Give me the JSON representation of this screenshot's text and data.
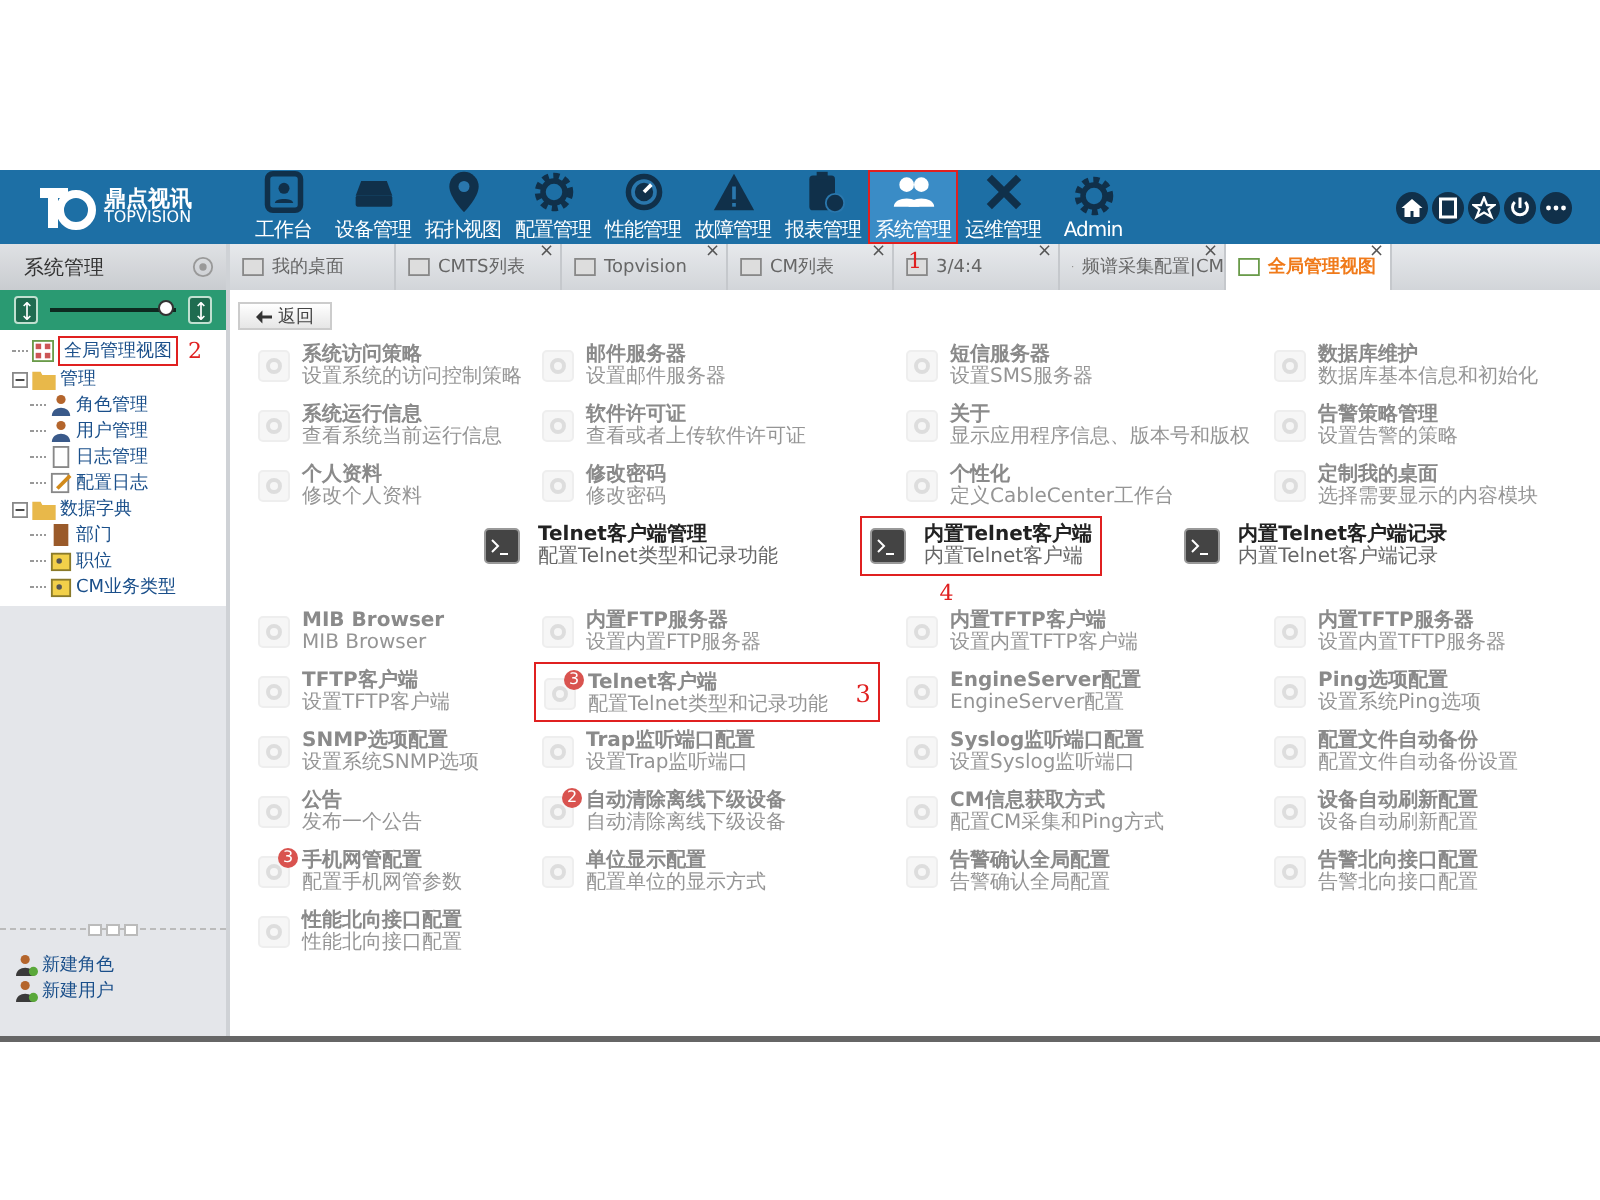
{
  "header": {
    "logo_cn": "鼎点视讯",
    "logo_en": "TOPVISION",
    "nav": [
      {
        "label": "工作台",
        "kind": "card",
        "selected": false
      },
      {
        "label": "设备管理",
        "kind": "drive",
        "selected": false
      },
      {
        "label": "拓扑视图",
        "kind": "pin",
        "selected": false
      },
      {
        "label": "配置管理",
        "kind": "gear",
        "selected": false
      },
      {
        "label": "性能管理",
        "kind": "gauge",
        "selected": false
      },
      {
        "label": "故障管理",
        "kind": "warning",
        "selected": false
      },
      {
        "label": "报表管理",
        "kind": "clipboard",
        "selected": false
      },
      {
        "label": "系统管理",
        "kind": "users",
        "selected": true,
        "annotation": "1"
      },
      {
        "label": "运维管理",
        "kind": "tools",
        "selected": false
      },
      {
        "label": "Admin",
        "kind": "gear",
        "selected": false
      }
    ],
    "actions": [
      {
        "kind": "home"
      },
      {
        "kind": "book"
      },
      {
        "kind": "star"
      },
      {
        "kind": "power"
      },
      {
        "kind": "more"
      }
    ]
  },
  "sidebar": {
    "title": "系统管理",
    "slider": {
      "level": 0.92
    },
    "tree": [
      {
        "label": "全局管理视图",
        "kind": "grid",
        "annotation": "2"
      },
      {
        "label": "管理",
        "kind": "folder",
        "expanded": true,
        "children": [
          {
            "label": "角色管理",
            "kind": "user"
          },
          {
            "label": "用户管理",
            "kind": "user"
          },
          {
            "label": "日志管理",
            "kind": "page"
          },
          {
            "label": "配置日志",
            "kind": "edit"
          }
        ]
      },
      {
        "label": "数据字典",
        "kind": "folder",
        "expanded": true,
        "children": [
          {
            "label": "部门",
            "kind": "door"
          },
          {
            "label": "职位",
            "kind": "badge"
          },
          {
            "label": "CM业务类型",
            "kind": "badge"
          }
        ]
      }
    ],
    "footer": [
      {
        "label": "新建角色"
      },
      {
        "label": "新建用户"
      }
    ]
  },
  "tabs": [
    {
      "label": "我的桌面",
      "selected": false
    },
    {
      "label": "CMTS列表",
      "selected": false,
      "close": "×"
    },
    {
      "label": "Topvision",
      "selected": false,
      "close": "×"
    },
    {
      "label": "CM列表",
      "selected": false,
      "close": "×"
    },
    {
      "label": "3/4:4",
      "selected": false,
      "close": "×"
    },
    {
      "label": "频谱采集配置|CM",
      "selected": false,
      "close": "×"
    },
    {
      "label": "全局管理视图",
      "selected": true,
      "close": "×"
    }
  ],
  "back_button": "返回",
  "grid": [
    {
      "title": "系统访问策略",
      "desc": "设置系统的访问控制策略"
    },
    {
      "title": "邮件服务器",
      "desc": "设置邮件服务器"
    },
    {
      "title": "短信服务器",
      "desc": "设置SMS服务器"
    },
    {
      "title": "数据库维护",
      "desc": "数据库基本信息和初始化"
    },
    {
      "title": "系统运行信息",
      "desc": "查看系统当前运行信息"
    },
    {
      "title": "软件许可证",
      "desc": "查看或者上传软件许可证"
    },
    {
      "title": "关于",
      "desc": "显示应用程序信息、版本号和版权"
    },
    {
      "title": "告警策略管理",
      "desc": "设置告警的策略"
    },
    {
      "title": "个人资料",
      "desc": "修改个人资料"
    },
    {
      "title": "修改密码",
      "desc": "修改密码"
    },
    {
      "title": "个性化",
      "desc": "定义CableCenter工作台"
    },
    {
      "title": "定制我的桌面",
      "desc": "选择需要显示的内容模块"
    },
    {
      "title": "MIB Browser",
      "desc": "MIB Browser"
    },
    {
      "title": "内置FTP服务器",
      "desc": "设置内置FTP服务器"
    },
    {
      "title": "内置TFTP客户端",
      "desc": "设置内置TFTP客户端"
    },
    {
      "title": "内置TFTP服务器",
      "desc": "设置内置TFTP服务器"
    },
    {
      "title": "TFTP客户端",
      "desc": "设置TFTP客户端"
    },
    {
      "title": "Telnet客户端",
      "desc": "配置Telnet类型和记录功能",
      "badge": "3",
      "annotation": "3"
    },
    {
      "title": "EngineServer配置",
      "desc": "EngineServer配置"
    },
    {
      "title": "Ping选项配置",
      "desc": "设置系统Ping选项"
    },
    {
      "title": "SNMP选项配置",
      "desc": "设置系统SNMP选项"
    },
    {
      "title": "Trap监听端口配置",
      "desc": "设置Trap监听端口"
    },
    {
      "title": "Syslog监听端口配置",
      "desc": "设置Syslog监听端口"
    },
    {
      "title": "配置文件自动备份",
      "desc": "配置文件自动备份设置"
    },
    {
      "title": "公告",
      "desc": "发布一个公告"
    },
    {
      "title": "自动清除离线下级设备",
      "desc": "自动清除离线下级设备",
      "badge": "2"
    },
    {
      "title": "CM信息获取方式",
      "desc": "配置CM采集和Ping方式"
    },
    {
      "title": "设备自动刷新配置",
      "desc": "设备自动刷新配置"
    },
    {
      "title": "手机网管配置",
      "desc": "配置手机网管参数",
      "badge": "3"
    },
    {
      "title": "单位显示配置",
      "desc": "配置单位的显示方式"
    },
    {
      "title": "告警确认全局配置",
      "desc": "告警确认全局配置"
    },
    {
      "title": "告警北向接口配置",
      "desc": "告警北向接口配置"
    },
    {
      "title": "性能北向接口配置",
      "desc": "性能北向接口配置"
    }
  ],
  "dragged": [
    {
      "title": "Telnet客户端管理",
      "desc": "配置Telnet类型和记录功能"
    },
    {
      "title": "内置Telnet客户端",
      "desc": "内置Telnet客户端",
      "annotation": "4"
    },
    {
      "title": "内置Telnet客户端记录",
      "desc": "内置Telnet客户端记录"
    }
  ]
}
